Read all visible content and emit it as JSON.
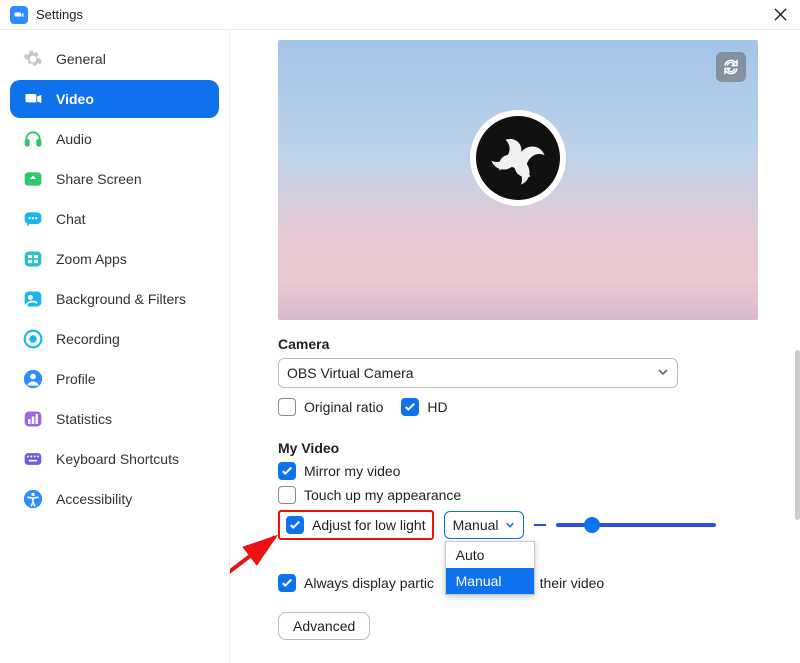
{
  "window": {
    "title": "Settings"
  },
  "sidebar": {
    "items": [
      {
        "label": "General",
        "id": "general"
      },
      {
        "label": "Video",
        "id": "video",
        "selected": true
      },
      {
        "label": "Audio",
        "id": "audio"
      },
      {
        "label": "Share Screen",
        "id": "share"
      },
      {
        "label": "Chat",
        "id": "chat"
      },
      {
        "label": "Zoom Apps",
        "id": "zoomapps"
      },
      {
        "label": "Background & Filters",
        "id": "bgfilters"
      },
      {
        "label": "Recording",
        "id": "recording"
      },
      {
        "label": "Profile",
        "id": "profile"
      },
      {
        "label": "Statistics",
        "id": "statistics"
      },
      {
        "label": "Keyboard Shortcuts",
        "id": "keyboard"
      },
      {
        "label": "Accessibility",
        "id": "accessibility"
      }
    ]
  },
  "camera": {
    "section_label": "Camera",
    "selected": "OBS Virtual Camera",
    "original_ratio_label": "Original ratio",
    "original_ratio_checked": false,
    "hd_label": "HD",
    "hd_checked": true
  },
  "myvideo": {
    "section_label": "My Video",
    "mirror_label": "Mirror my video",
    "mirror_checked": true,
    "touchup_label": "Touch up my appearance",
    "touchup_checked": false,
    "lowlight_label": "Adjust for low light",
    "lowlight_checked": true,
    "lowlight_mode_selected": "Manual",
    "lowlight_mode_options": [
      "Auto",
      "Manual"
    ],
    "always_display_label_part1": "Always display partic",
    "always_display_label_part2": "n their video",
    "always_display_checked": true,
    "advanced_label": "Advanced"
  },
  "dropdown_options": {
    "opt0": "Auto",
    "opt1": "Manual"
  },
  "accent": "#0e72ec"
}
